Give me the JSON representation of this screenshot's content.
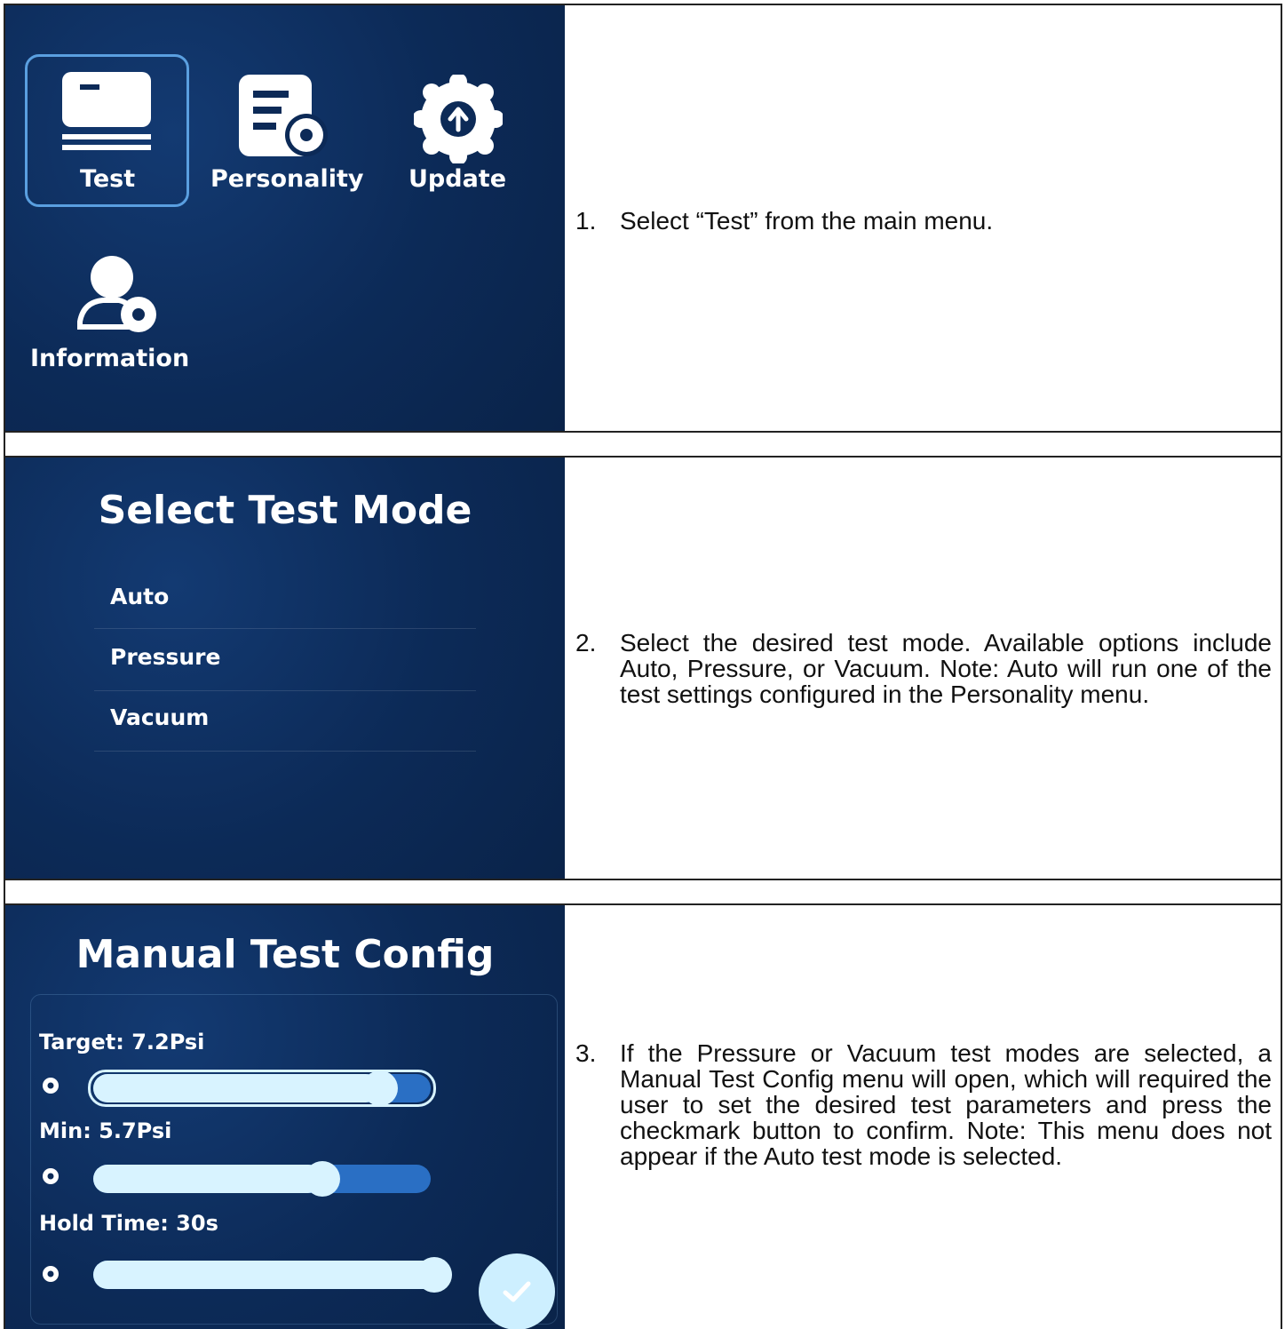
{
  "rows": [
    {
      "step_number": "1.",
      "step_text": "Select “Test” from the main menu.",
      "screen": {
        "tiles": [
          {
            "label": "Test",
            "icon": "test-device-icon",
            "selected": true
          },
          {
            "label": "Personality",
            "icon": "document-gear-icon",
            "selected": false
          },
          {
            "label": "Update",
            "icon": "upload-badge-icon",
            "selected": false
          },
          {
            "label": "Information",
            "icon": "user-gear-icon",
            "selected": false
          }
        ]
      }
    },
    {
      "step_number": "2.",
      "step_text": "Select the desired test mode. Available options include Auto, Pressure, or Vacuum. Note: Auto will run one of the test settings configured in the Personality menu.",
      "screen": {
        "title": "Select Test Mode",
        "options": [
          "Auto",
          "Pressure",
          "Vacuum"
        ]
      }
    },
    {
      "step_number": "3.",
      "step_text": "If the Pressure or Vacuum test modes are selected, a Manual Test Config menu will open, which will required the user to set the desired test parameters and press the checkmark button to confirm. Note: This menu does not appear if the Auto test mode is selected.",
      "screen": {
        "title": "Manual Test Config",
        "sliders": [
          {
            "label": "Target: 7.2Psi",
            "fraction": 0.85,
            "focused": true
          },
          {
            "label": "Min: 5.7Psi",
            "fraction": 0.68,
            "focused": false
          },
          {
            "label": "Hold Time: 30s",
            "fraction": 1.0,
            "focused": false
          }
        ],
        "confirm_icon": "checkmark-icon"
      }
    }
  ],
  "colors": {
    "screen_bg": "#0c2a57",
    "accent": "#5a9fe0",
    "slider_fill": "#d8f3ff",
    "slider_track": "#2a6fc4"
  }
}
